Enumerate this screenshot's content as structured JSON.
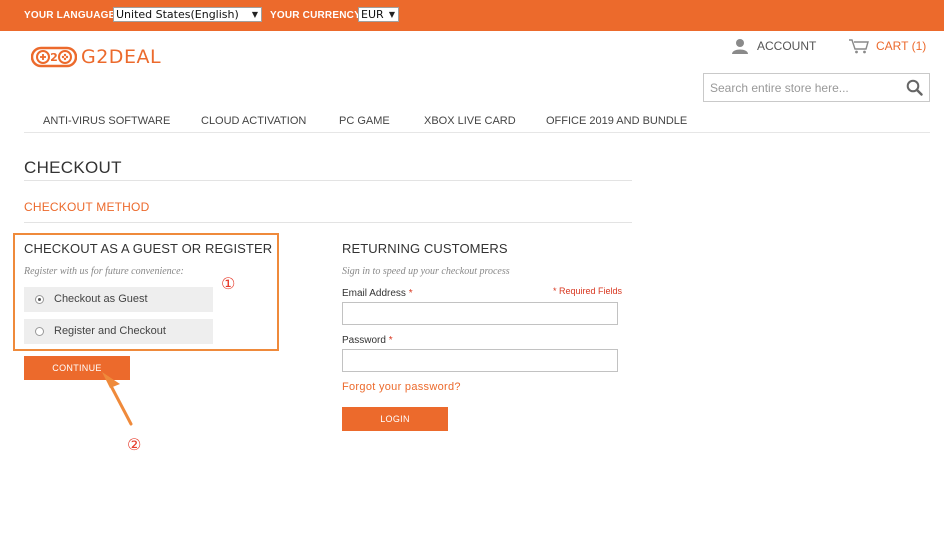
{
  "colors": {
    "accent": "#ec6a2c",
    "highlight_box": "#ef8a3b",
    "marker": "#e63b2b",
    "required": "#d8361f"
  },
  "topbar": {
    "language_label": "YOUR LANGUAGE:",
    "language_value": "United States(English)",
    "currency_label": "YOUR CURRENCY:",
    "currency_value": "EUR"
  },
  "header": {
    "logo_text": "G2DEAL",
    "account_label": "ACCOUNT",
    "cart_label": "CART (1)",
    "search_placeholder": "Search entire store here..."
  },
  "nav": {
    "items": [
      {
        "label": "ANTI-VIRUS SOFTWARE"
      },
      {
        "label": "CLOUD ACTIVATION"
      },
      {
        "label": "PC GAME"
      },
      {
        "label": "XBOX LIVE CARD"
      },
      {
        "label": "OFFICE 2019 AND BUNDLE"
      }
    ]
  },
  "checkout": {
    "title": "CHECKOUT",
    "method_label": "CHECKOUT METHOD",
    "guest": {
      "title": "CHECKOUT AS A GUEST OR REGISTER",
      "subtitle": "Register with us for future convenience:",
      "options": [
        {
          "label": "Checkout as Guest",
          "selected": true
        },
        {
          "label": "Register and Checkout",
          "selected": false
        }
      ],
      "continue_label": "CONTINUE"
    },
    "returning": {
      "title": "RETURNING CUSTOMERS",
      "subtitle": "Sign in to speed up your checkout process",
      "required_note": "* Required Fields",
      "email_label": "Email Address",
      "password_label": "Password",
      "required_star": "*",
      "forgot_label": "Forgot your password?",
      "login_label": "LOGIN"
    }
  },
  "annotations": {
    "marker_1": "①",
    "marker_2": "②"
  }
}
